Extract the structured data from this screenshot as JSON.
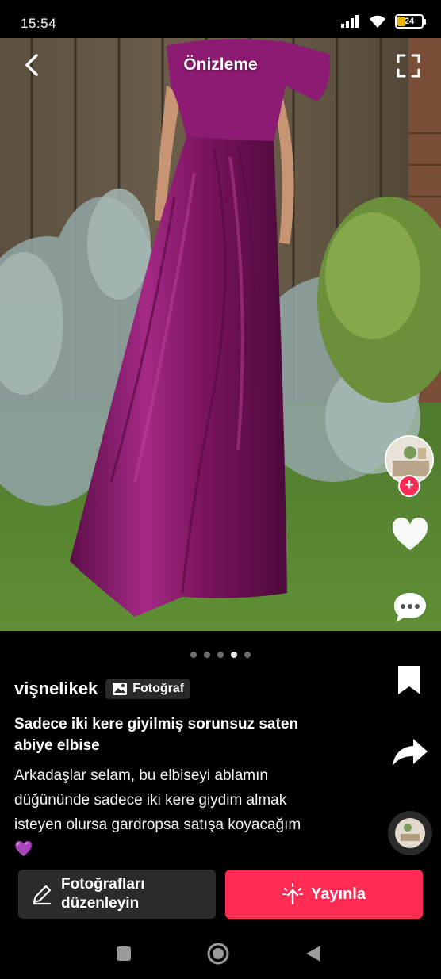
{
  "status_bar": {
    "time": "15:54",
    "battery_level": "24",
    "icons": [
      "signal-icon",
      "wifi-icon",
      "battery-icon"
    ]
  },
  "header": {
    "title": "Önizleme",
    "back_icon": "chevron-left-icon",
    "expand_icon": "expand-icon"
  },
  "right_rail": {
    "items": [
      "avatar",
      "add-plus-icon",
      "heart-icon",
      "comment-icon",
      "bookmark-icon",
      "share-icon",
      "sound-disc"
    ]
  },
  "carousel": {
    "total_pages": 5,
    "active_page": 4
  },
  "post": {
    "username": "vişnelikek",
    "badge_label": "Fotoğraf",
    "title": "Sadece iki kere giyilmiş sorunsuz saten abiye elbise",
    "description": "Arkadaşlar selam, bu elbiseyi ablamın düğününde sadece iki kere giydim almak isteyen olursa gardropsa satışa koyacağım 💜"
  },
  "actions": {
    "edit_label": "Fotoğrafları düzenleyin",
    "publish_label": "Yayınla"
  },
  "colors": {
    "accent": "#fe2c55",
    "dress": "#8a1a6e",
    "background": "#000000"
  }
}
